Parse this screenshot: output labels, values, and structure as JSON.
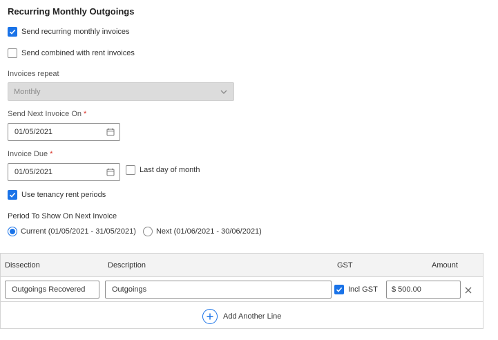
{
  "section": {
    "title": "Recurring Monthly Outgoings"
  },
  "options": {
    "send_recurring": {
      "label": "Send recurring monthly invoices",
      "checked": true
    },
    "send_combined": {
      "label": "Send combined with rent invoices",
      "checked": false
    },
    "use_tenancy": {
      "label": "Use tenancy rent periods",
      "checked": true
    },
    "last_day": {
      "label": "Last day of month",
      "checked": false
    }
  },
  "repeat": {
    "label": "Invoices repeat",
    "value": "Monthly"
  },
  "send_next": {
    "label": "Send Next Invoice On",
    "required_mark": "*",
    "value": "01/05/2021"
  },
  "invoice_due": {
    "label": "Invoice Due",
    "required_mark": "*",
    "value": "01/05/2021"
  },
  "period": {
    "label": "Period To Show On Next Invoice",
    "options": [
      {
        "label": "Current (01/05/2021 - 31/05/2021)",
        "selected": true
      },
      {
        "label": "Next (01/06/2021 - 30/06/2021)",
        "selected": false
      }
    ]
  },
  "table": {
    "headers": {
      "dissection": "Dissection",
      "description": "Description",
      "gst": "GST",
      "amount": "Amount"
    },
    "rows": [
      {
        "dissection": "Outgoings Recovered",
        "description": "Outgoings",
        "gst_label": "Incl GST",
        "gst_checked": true,
        "amount": "$ 500.00"
      }
    ],
    "add_line": "Add Another Line"
  },
  "colors": {
    "accent": "#1a73e8",
    "required": "#d93025",
    "disabled_bg": "#dcdcdc"
  },
  "icons": {
    "calendar": "calendar-icon",
    "chevron": "chevron-down-icon",
    "close": "close-icon",
    "add": "plus-circle-icon"
  }
}
